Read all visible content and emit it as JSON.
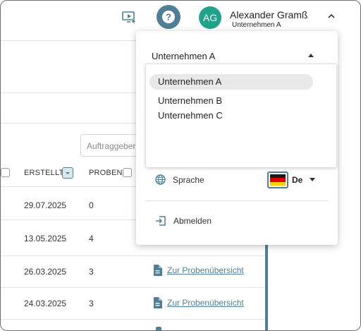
{
  "header": {
    "user_initials": "AG",
    "user_name": "Alexander Gramß",
    "user_company": "Unternehmen A"
  },
  "table": {
    "filter_placeholder": "Auftraggeber",
    "columns": [
      "ERSTELLT",
      "PROBEN"
    ],
    "rows": [
      {
        "created": "29.07.2025",
        "samples": "0",
        "link": ""
      },
      {
        "created": "13.05.2025",
        "samples": "4",
        "link": ""
      },
      {
        "created": "26.03.2025",
        "samples": "3",
        "link": "Zur Probenübersicht"
      },
      {
        "created": "24.03.2025",
        "samples": "3",
        "link": "Zur Probenübersicht"
      }
    ]
  },
  "menu": {
    "company_selected": "Unternehmen A",
    "company_options": [
      "Unternehmen A",
      "Unternehmen B",
      "Unternehmen C"
    ],
    "language_label": "Sprache",
    "language_code": "De",
    "logout_label": "Abmelden"
  },
  "colors": {
    "accent": "#4f7f96",
    "avatar": "#1fa38a"
  }
}
